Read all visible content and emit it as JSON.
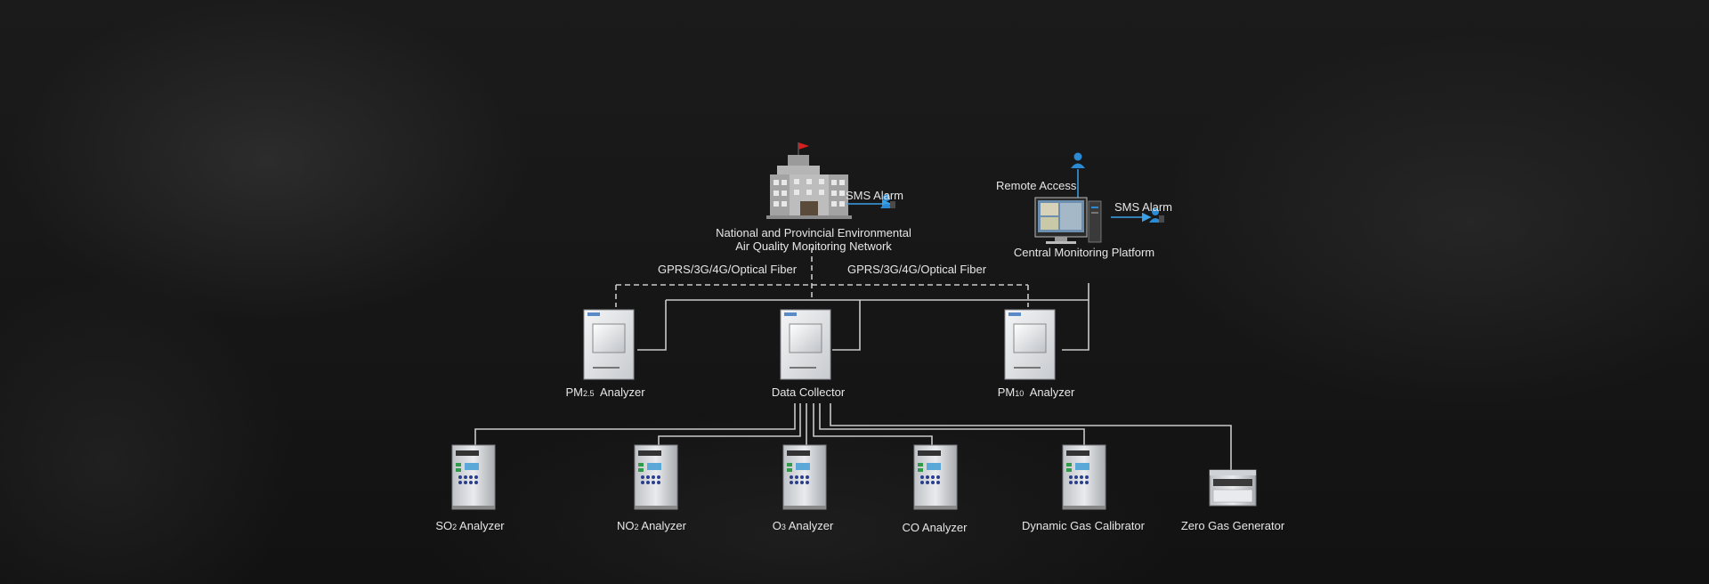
{
  "hq": {
    "label_line1": "National and Provincial Environmental",
    "label_line2": "Air Quality Monitoring Network",
    "sms_alarm": "SMS Alarm"
  },
  "platform": {
    "remote_access": "Remote Access",
    "sms_alarm": "SMS Alarm",
    "label": "Central Monitoring Platform"
  },
  "links": {
    "left": "GPRS/3G/4G/Optical Fiber",
    "right": "GPRS/3G/4G/Optical Fiber"
  },
  "tier2": {
    "pm25": {
      "prefix": "PM",
      "sub": "2.5",
      "suffix": "  Analyzer"
    },
    "collector": "Data Collector",
    "pm10": {
      "prefix": "PM",
      "sub": "10",
      "suffix": "  Analyzer"
    }
  },
  "tier3": {
    "so2": {
      "prefix": "SO",
      "sub": "2",
      "suffix": " Analyzer"
    },
    "no2": {
      "prefix": "NO",
      "sub": "2",
      "suffix": " Analyzer"
    },
    "o3": {
      "prefix": "O",
      "sub": "3",
      "suffix": " Analyzer"
    },
    "co": "CO Analyzer",
    "calibrator": "Dynamic Gas Calibrator",
    "zero_gas": "Zero Gas Generator"
  },
  "colors": {
    "line": "#c9c9c9",
    "text": "#e6e6e6",
    "accent_blue": "#2a8ad4",
    "flag_red": "#d42020"
  }
}
